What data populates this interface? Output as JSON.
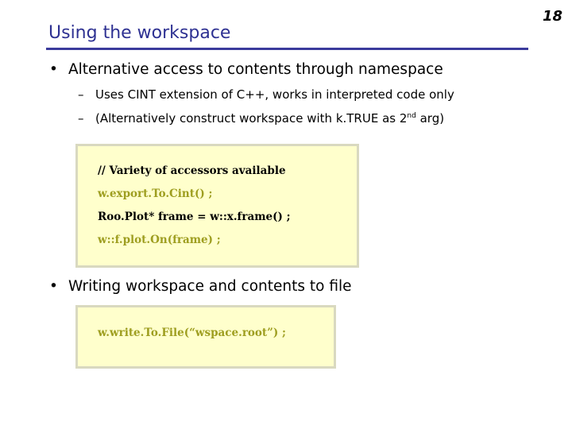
{
  "page_number": "18",
  "title": "Using the workspace",
  "bullets": [
    {
      "text": "Alternative access to contents through namespace",
      "subitems": [
        {
          "text": "Uses CINT extension of C++, works in interpreted code only"
        },
        {
          "text_before": "(Alternatively construct workspace with k.TRUE as 2",
          "sup": "nd",
          "text_after": " arg)"
        }
      ]
    },
    {
      "text": "Writing workspace and contents to file"
    }
  ],
  "code_block_1": {
    "lines": [
      "// Variety of accessors available",
      "w.export.To.Cint() ;",
      "Roo.Plot* frame = w::x.frame() ;",
      "w::f.plot.On(frame) ;"
    ]
  },
  "code_block_2": {
    "lines": [
      "w.write.To.File(“wspace.root”) ;"
    ]
  },
  "colors": {
    "title": "#2e3192",
    "rule": "#3b3b9c",
    "code_background": "#ffffcc",
    "code_text": "#000000",
    "code_secondary": "#9e9e20"
  }
}
